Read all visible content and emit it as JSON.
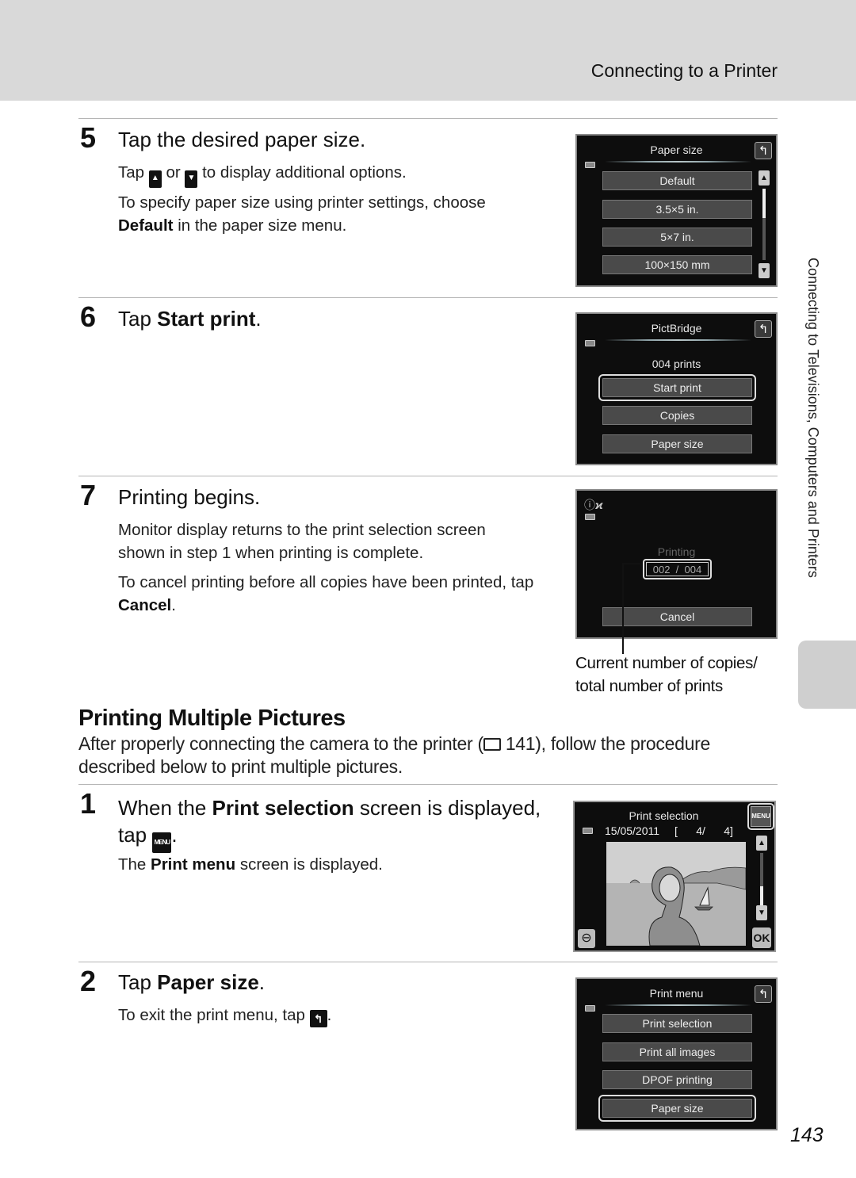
{
  "header": {
    "section_title": "Connecting to a Printer"
  },
  "side_tab": {
    "label": "Connecting to Televisions, Computers and Printers"
  },
  "page_number": "143",
  "steps_top": [
    {
      "number": "5",
      "heading": "Tap the desired paper size.",
      "lines": {
        "tap": "Tap",
        "or": "or",
        "rest": "to display additional options.",
        "p2_pre": "To specify paper size using printer settings, choose",
        "p2_bold": "Default",
        "p2_post": "in the paper size menu."
      },
      "screen": {
        "title": "Paper size",
        "options": [
          "Default",
          "3.5×5 in.",
          "5×7 in.",
          "100×150 mm"
        ]
      }
    },
    {
      "number": "6",
      "heading_pre": "Tap",
      "heading_bold": "Start print",
      "heading_post": ".",
      "screen": {
        "title": "PictBridge",
        "count": "004 prints",
        "options": [
          "Start print",
          "Copies",
          "Paper size"
        ],
        "selected": "Start print"
      }
    },
    {
      "number": "7",
      "heading": "Printing begins.",
      "p1": "Monitor display returns to the print selection screen shown in step 1 when printing is complete.",
      "p2_pre": "To cancel printing before all copies have been printed, tap",
      "p2_bold": "Cancel",
      "p2_post": ".",
      "screen": {
        "status": "Printing",
        "progress": "002  /  004",
        "progress_current": 2,
        "progress_total": 4,
        "cancel": "Cancel"
      },
      "callout": "Current number of copies/ total number of prints"
    }
  ],
  "multi": {
    "title": "Printing Multiple Pictures",
    "intro_pre": "After properly connecting the camera to the printer (",
    "intro_ref": "141), follow the procedure described below to print multiple pictures.",
    "steps": [
      {
        "number": "1",
        "heading_pre": "When the",
        "heading_bold": "Print selection",
        "heading_post": "screen is displayed,",
        "heading_line2": "tap",
        "menu_icon": "MENU",
        "body_pre": "The",
        "body_bold": "Print menu",
        "body_post": "screen is displayed.",
        "screen": {
          "title": "Print selection",
          "date": "15/05/2011",
          "counter": "[      4/      4]",
          "menu_label": "MENU",
          "ok_label": "OK"
        }
      },
      {
        "number": "2",
        "heading_pre": "Tap",
        "heading_bold": "Paper size",
        "heading_post": ".",
        "body": "To exit the print menu, tap",
        "screen": {
          "title": "Print menu",
          "options": [
            "Print selection",
            "Print all images",
            "DPOF printing",
            "Paper size"
          ],
          "selected": "Paper size"
        }
      }
    ]
  },
  "icons": {
    "back": "↰",
    "up": "▲",
    "down": "▼",
    "book": "📖",
    "zoom_out": "⊖"
  }
}
